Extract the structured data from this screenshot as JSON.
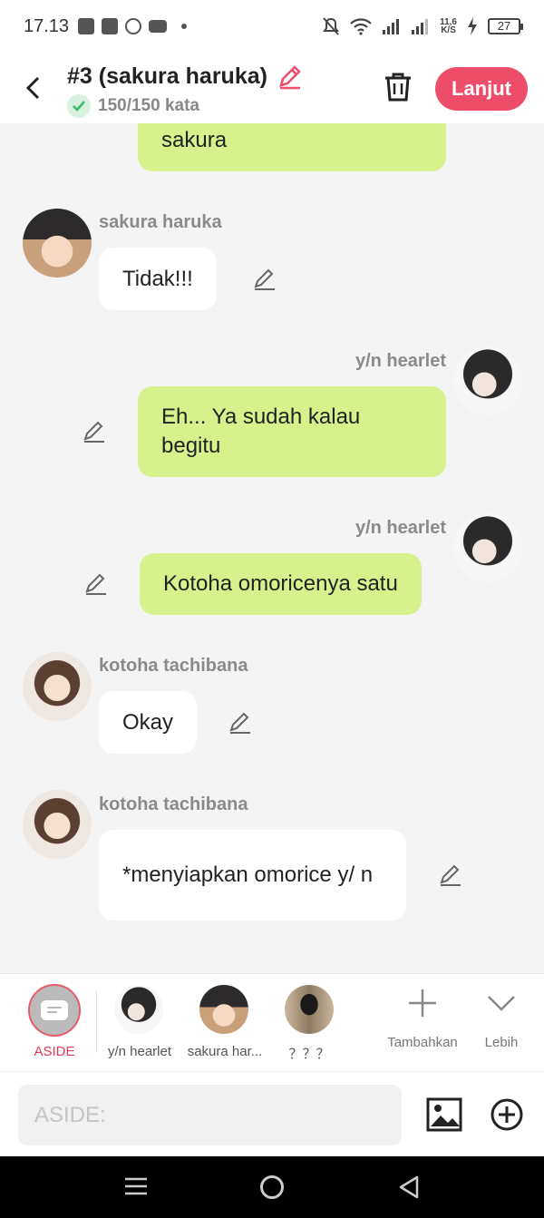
{
  "status_bar": {
    "time": "17.13",
    "speed": "11,6\nK/S",
    "battery": "27"
  },
  "header": {
    "title": "#3 (sakura haruka)",
    "word_count": "150/150 kata",
    "next_button": "Lanjut"
  },
  "chat": {
    "messages": [
      {
        "sender": "",
        "side": "right",
        "text": "sakura"
      },
      {
        "sender": "sakura haruka",
        "side": "left",
        "text": "Tidak!!!"
      },
      {
        "sender": "y/n hearlet",
        "side": "right",
        "text": "Eh... Ya sudah kalau begitu"
      },
      {
        "sender": "y/n hearlet",
        "side": "right",
        "text": "Kotoha omoricenya satu"
      },
      {
        "sender": "kotoha tachibana",
        "side": "left",
        "text": "Okay"
      },
      {
        "sender": "kotoha tachibana",
        "side": "left",
        "text": "*menyiapkan omorice y/ n"
      }
    ]
  },
  "characters": {
    "aside": "ASIDE",
    "items": [
      {
        "label": "y/n hearlet"
      },
      {
        "label": "sakura har..."
      },
      {
        "label": "？？？"
      }
    ],
    "add_label": "Tambahkan",
    "more_label": "Lebih"
  },
  "input": {
    "placeholder": "ASIDE:"
  },
  "colors": {
    "accent": "#ee4d6a",
    "right_bubble": "#d7f28d",
    "left_bubble": "#ffffff"
  }
}
